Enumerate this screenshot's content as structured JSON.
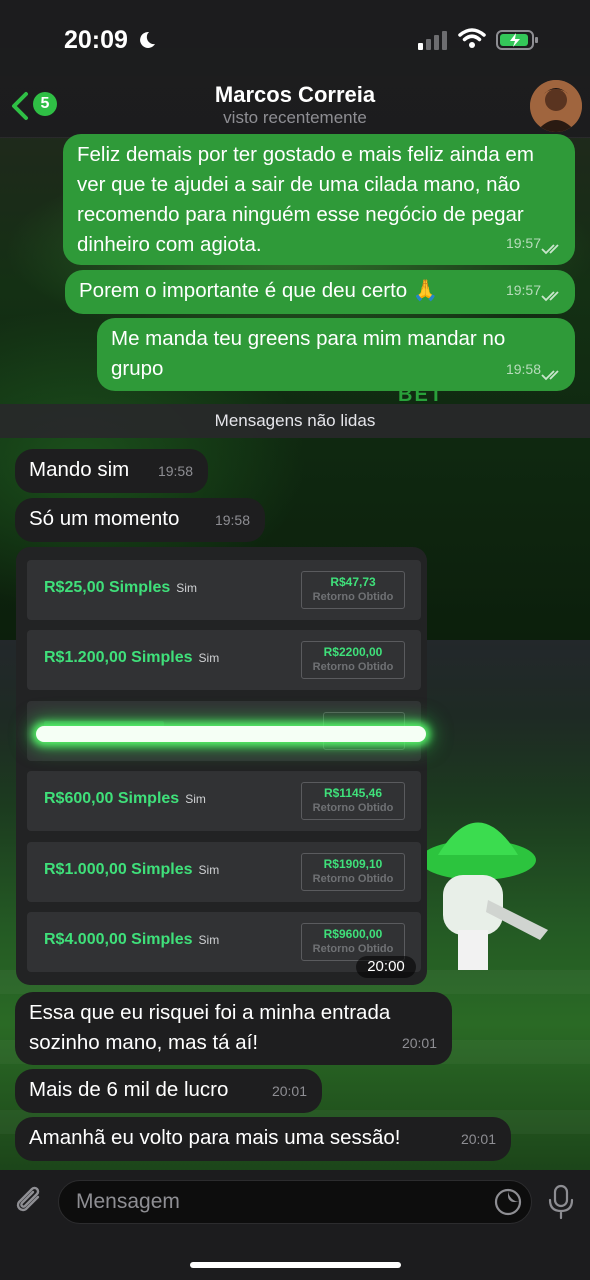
{
  "status_bar": {
    "time": "20:09"
  },
  "header": {
    "back_badge": "5",
    "name": "Marcos Correia",
    "status": "visto recentemente"
  },
  "messages_top": [
    {
      "text": "Feliz demais por ter gostado e mais feliz ainda em ver que te ajudei a sair de uma cilada mano, não recomendo para ninguém esse negócio de pegar dinheiro com agiota.",
      "time": "19:57"
    },
    {
      "text": "Porem o importante é que deu certo 🙏",
      "time": "19:57"
    },
    {
      "text": "Me manda teu greens para mim mandar no grupo",
      "time": "19:58"
    }
  ],
  "unread_label": "Mensagens não lidas",
  "messages_in": [
    {
      "text": "Mando sim",
      "time": "19:58"
    },
    {
      "text": "Só um momento",
      "time": "19:58"
    }
  ],
  "bet_image": {
    "time": "20:00",
    "rows": [
      {
        "label": "R$25,00 Simples",
        "sim": "Sim",
        "value": "R$47,73",
        "sub": "Retorno Obtido"
      },
      {
        "label": "R$1.200,00 Simples",
        "sim": "Sim",
        "value": "R$2200,00",
        "sub": "Retorno Obtido"
      },
      {
        "label": "R$600,00 Simples",
        "sim": "Sim",
        "value": "R$1145,46",
        "sub": "Retorno Obtido"
      },
      {
        "label": "R$1.000,00 Simples",
        "sim": "Sim",
        "value": "R$1909,10",
        "sub": "Retorno Obtido"
      },
      {
        "label": "R$4.000,00 Simples",
        "sim": "Sim",
        "value": "R$9600,00",
        "sub": "Retorno Obtido"
      }
    ]
  },
  "messages_bottom": [
    {
      "text": "Essa que eu risquei foi a minha entrada sozinho mano, mas tá aí!",
      "time": "20:01"
    },
    {
      "text": "Mais de 6 mil de lucro",
      "time": "20:01"
    },
    {
      "text": "Amanhã eu volto para mais uma sessão!",
      "time": "20:01"
    }
  ],
  "composer": {
    "placeholder": "Mensagem"
  },
  "background_text": "BET",
  "colors": {
    "outgoing": "#2f9a39",
    "incoming": "#1e1e1f",
    "accent": "#2fbf45",
    "bet_green": "#3fe07a"
  }
}
